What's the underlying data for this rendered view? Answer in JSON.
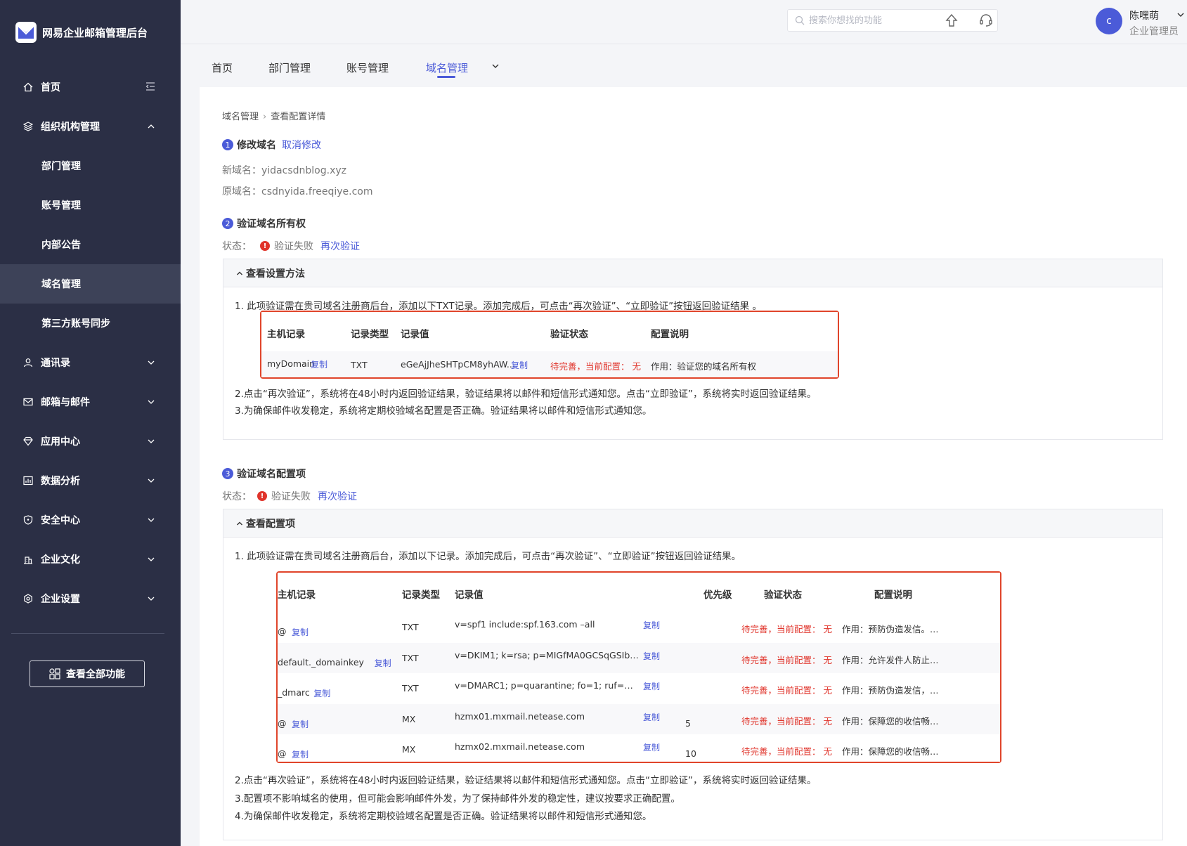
{
  "app": {
    "title": "网易企业邮箱管理后台"
  },
  "sidebar": {
    "items": [
      {
        "label": "首页"
      },
      {
        "label": "组织机构管理"
      },
      {
        "label": "部门管理"
      },
      {
        "label": "账号管理"
      },
      {
        "label": "内部公告"
      },
      {
        "label": "域名管理"
      },
      {
        "label": "第三方账号同步"
      },
      {
        "label": "通讯录"
      },
      {
        "label": "邮箱与邮件"
      },
      {
        "label": "应用中心"
      },
      {
        "label": "数据分析"
      },
      {
        "label": "安全中心"
      },
      {
        "label": "企业文化"
      },
      {
        "label": "企业设置"
      }
    ],
    "all_features_label": "查看全部功能"
  },
  "topbar": {
    "search_placeholder": "搜索你想找的功能",
    "avatar_letter": "c",
    "user_name": "陈嘿萌",
    "user_role": "企业管理员"
  },
  "tabs": [
    {
      "label": "首页"
    },
    {
      "label": "部门管理"
    },
    {
      "label": "账号管理"
    },
    {
      "label": "域名管理"
    }
  ],
  "breadcrumb": {
    "parent": "域名管理",
    "current": "查看配置详情"
  },
  "step1": {
    "number": "1",
    "title": "修改域名",
    "action": "取消修改",
    "new_domain": "新域名：yidacsdnblog.xyz",
    "old_domain": "原域名：csdnyida.freeqiye.com"
  },
  "step2": {
    "number": "2",
    "title": "验证域名所有权",
    "status_label": "状态：",
    "status_value": "验证失败",
    "action": "再次验证",
    "panel_title": "查看设置方法",
    "line1": "1. 此项验证需在贵司域名注册商后台，添加以下TXT记录。添加完成后，可点击“再次验证”、“立即验证”按钮返回验证结果 。",
    "line2": "2.点击“再次验证”，系统将在48小时内返回验证结果，验证结果将以邮件和短信形式通知您。点击“立即验证”，系统将实时返回验证结果。",
    "line3": "3.为确保邮件收发稳定，系统将定期校验域名配置是否正确。验证结果将以邮件和短信形式通知您。",
    "columns": [
      "主机记录",
      "记录类型",
      "记录值",
      "验证状态",
      "配置说明"
    ],
    "row": {
      "host": "myDomain",
      "copy": "复制",
      "type": "TXT",
      "value": "eGeAjJheSHTpCM8yhAW...",
      "status": "待完善，当前配置： 无",
      "desc": "作用：验证您的域名所有权"
    }
  },
  "step3": {
    "number": "3",
    "title": "验证域名配置项",
    "status_label": "状态：",
    "status_value": "验证失败",
    "action": "再次验证",
    "panel_title": "查看配置项",
    "line1": "1. 此项验证需在贵司域名注册商后台，添加以下记录。添加完成后，可点击“再次验证”、“立即验证”按钮返回验证结果。",
    "line2": "2.点击“再次验证”，系统将在48小时内返回验证结果，验证结果将以邮件和短信形式通知您。点击“立即验证”，系统将实时返回验证结果。",
    "line3": "3.配置项不影响域名的使用，但可能会影响邮件外发，为了保持邮件外发的稳定性，建议按要求正确配置。",
    "line4": "4.为确保邮件收发稳定，系统将定期校验域名配置是否正确。验证结果将以邮件和短信形式通知您。",
    "columns": [
      "主机记录",
      "记录类型",
      "记录值",
      "优先级",
      "验证状态",
      "配置说明"
    ],
    "copy": "复制",
    "rows": [
      {
        "host": "@",
        "type": "TXT",
        "value": "v=spf1 include:spf.163.com –all",
        "priority": "",
        "status": "待完善，当前配置： 无",
        "desc": "作用：预防伪造发信。说..."
      },
      {
        "host": "default._domainkey",
        "type": "TXT",
        "value": "v=DKIM1; k=rsa; p=MIGfMA0GCSqGSIb3DQEBA...",
        "priority": "",
        "status": "待完善，当前配置： 无",
        "desc": "作用：允许发件人防止电..."
      },
      {
        "host": "_dmarc",
        "type": "TXT",
        "value": "v=DMARC1; p=quarantine; fo=1; ruf=mailto:dma...",
        "priority": "",
        "status": "待完善，当前配置： 无",
        "desc": "作用：预防伪造发信，有..."
      },
      {
        "host": "@",
        "type": "MX",
        "value": "hzmx01.mxmail.netease.com",
        "priority": "5",
        "status": "待完善，当前配置： 无",
        "desc": "作用：保障您的收信畅通..."
      },
      {
        "host": "@",
        "type": "MX",
        "value": "hzmx02.mxmail.netease.com",
        "priority": "10",
        "status": "待完善，当前配置： 无",
        "desc": "作用：保障您的收信畅通..."
      }
    ]
  }
}
